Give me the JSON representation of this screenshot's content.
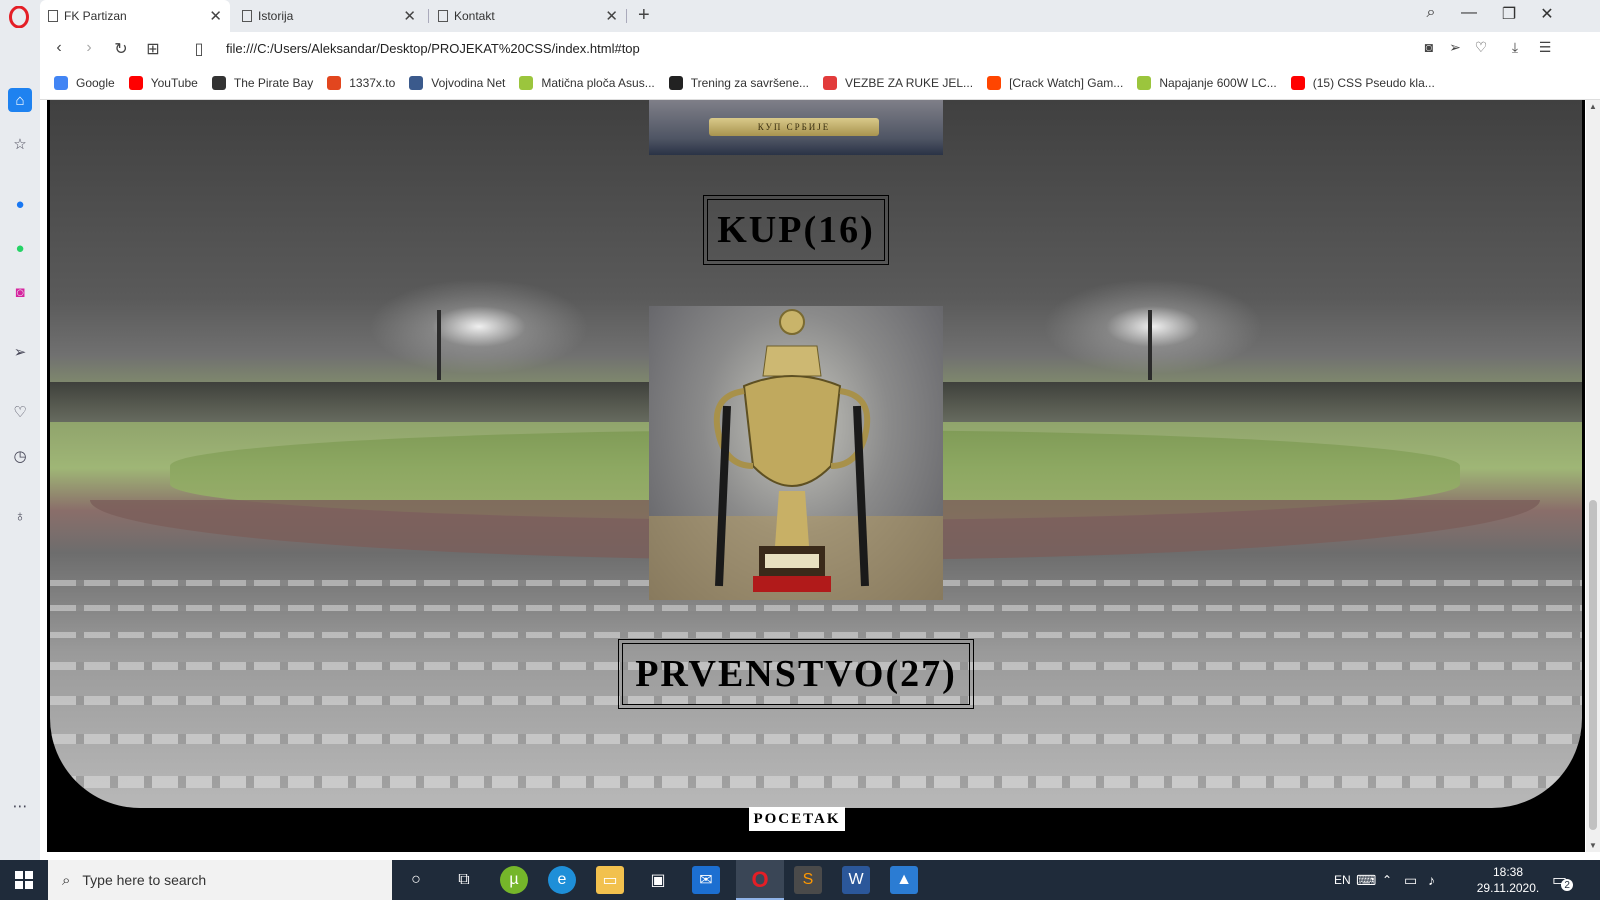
{
  "browser": {
    "tabs": [
      {
        "label": "FK Partizan",
        "active": true
      },
      {
        "label": "Istorija",
        "active": false
      },
      {
        "label": "Kontakt",
        "active": false
      }
    ],
    "url": "file:///C:/Users/Aleksandar/Desktop/PROJEKAT%20CSS/index.html#top",
    "bookmarks": [
      {
        "label": "Google",
        "icon": "google-icon",
        "color": "#4285f4"
      },
      {
        "label": "YouTube",
        "icon": "youtube-icon",
        "color": "#ff0000"
      },
      {
        "label": "The Pirate Bay",
        "icon": "pirate-ship-icon",
        "color": "#333333"
      },
      {
        "label": "1337x.to",
        "icon": "x-icon",
        "color": "#e2461e"
      },
      {
        "label": "Vojvodina Net",
        "icon": "v-icon",
        "color": "#3b5a8c"
      },
      {
        "label": "Matična ploča Asus...",
        "icon": "site-icon",
        "color": "#9bc53d"
      },
      {
        "label": "Trening za savršene...",
        "icon": "z-icon",
        "color": "#222222"
      },
      {
        "label": "VEZBE ZA RUKE JEL...",
        "icon": "site-icon",
        "color": "#e23b3b"
      },
      {
        "label": "[Crack Watch] Gam...",
        "icon": "reddit-icon",
        "color": "#ff4500"
      },
      {
        "label": "Napajanje 600W LC...",
        "icon": "site-icon",
        "color": "#9bc53d"
      },
      {
        "label": "(15) CSS Pseudo kla...",
        "icon": "youtube-icon",
        "color": "#ff0000"
      }
    ]
  },
  "page": {
    "kup_title": "KUP(16)",
    "prvenstvo_title": "PRVENSTVO(27)",
    "pocetak_button": "POCETAK",
    "cup_caption": "КУП СРБИЈЕ"
  },
  "taskbar": {
    "search_placeholder": "Type here to search",
    "language": "EN",
    "time": "18:38",
    "date": "29.11.2020.",
    "notification_count": "2"
  }
}
